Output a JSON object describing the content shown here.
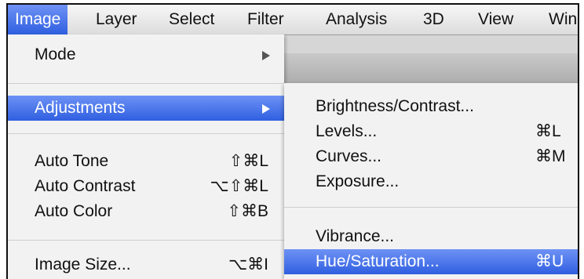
{
  "menubar": {
    "items": [
      {
        "label": "Image",
        "active": true
      },
      {
        "label": "Layer"
      },
      {
        "label": "Select"
      },
      {
        "label": "Filter"
      },
      {
        "label": "Analysis"
      },
      {
        "label": "3D"
      },
      {
        "label": "View"
      },
      {
        "label": "Win"
      }
    ]
  },
  "image_menu": {
    "items": [
      {
        "label": "Mode",
        "submenu": true
      },
      {
        "label": "Adjustments",
        "submenu": true,
        "selected": true
      },
      {
        "label": "Auto Tone",
        "shortcut": "⇧⌘L"
      },
      {
        "label": "Auto Contrast",
        "shortcut": "⌥⇧⌘L"
      },
      {
        "label": "Auto Color",
        "shortcut": "⇧⌘B"
      },
      {
        "label": "Image Size...",
        "shortcut": "⌥⌘I"
      }
    ]
  },
  "adjustments_menu": {
    "items": [
      {
        "label": "Brightness/Contrast..."
      },
      {
        "label": "Levels...",
        "shortcut": "⌘L"
      },
      {
        "label": "Curves...",
        "shortcut": "⌘M"
      },
      {
        "label": "Exposure..."
      },
      {
        "label": "Vibrance..."
      },
      {
        "label": "Hue/Saturation...",
        "shortcut": "⌘U",
        "selected": true
      }
    ]
  },
  "colors": {
    "highlight": "#2f5fe0",
    "menu_bg": "#f2f2f2"
  }
}
